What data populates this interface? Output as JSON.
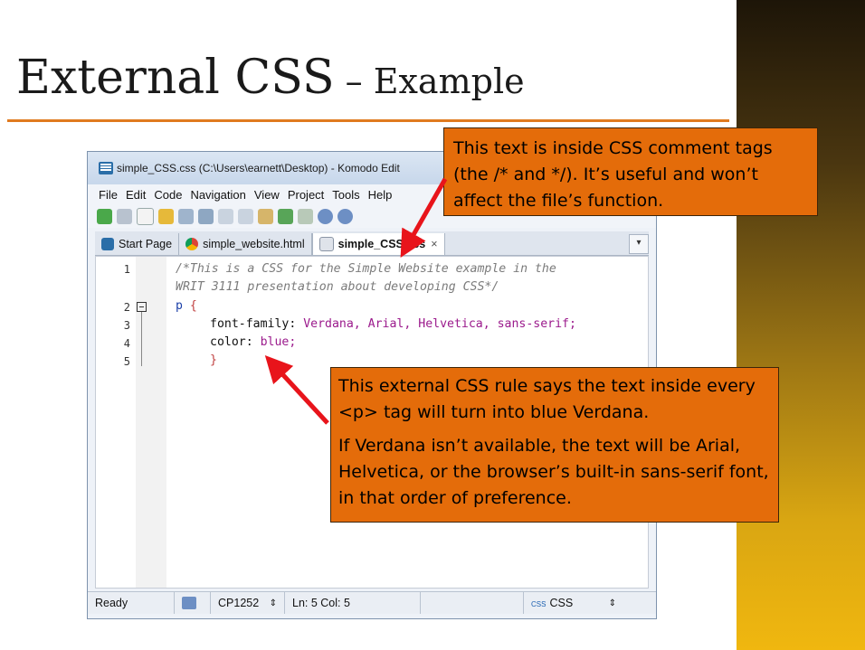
{
  "slide": {
    "title_main": "External CSS",
    "title_dash": " – ",
    "title_sub": "Example"
  },
  "window": {
    "title": "simple_CSS.css (C:\\Users\\earnett\\Desktop) - Komodo Edit",
    "menu": [
      "File",
      "Edit",
      "Code",
      "Navigation",
      "View",
      "Project",
      "Tools",
      "Help"
    ],
    "tabs": [
      {
        "label": "Start Page",
        "icon": "komodo-icon"
      },
      {
        "label": "simple_website.html",
        "icon": "chrome-icon"
      },
      {
        "label": "simple_CSS.css",
        "icon": "css-file-icon",
        "close": "×"
      }
    ],
    "tab_menu_glyph": "▾"
  },
  "editor": {
    "line_numbers": [
      "1",
      "2",
      "3",
      "4",
      "5"
    ],
    "comment_line1": "/*This is a CSS for the Simple Website example in the",
    "comment_line2": "WRIT 3111 presentation about developing CSS*/",
    "selector": "p",
    "open_brace": " {",
    "prop1": "font-family:",
    "val1": " Verdana, Arial, Helvetica, sans-serif;",
    "prop2": "color:",
    "val2": " blue;",
    "close_brace": "}"
  },
  "statusbar": {
    "ready": "Ready",
    "encoding": "CP1252",
    "position": "Ln: 5 Col: 5",
    "language_prefix": "CSS",
    "language": "CSS",
    "spinner": "⇕"
  },
  "callouts": {
    "top": "This text is inside CSS comment tags (the /* and */). It’s useful and won’t affect the file’s function.",
    "bottom_p1": "This external CSS rule says the text inside every <p> tag will turn into blue Verdana.",
    "bottom_p2": "If Verdana isn’t available, the text will be Arial, Helvetica, or the browser’s built-in sans-serif font, in that order of preference."
  },
  "colors": {
    "accent_orange": "#e46c0a",
    "title_rule": "#e07a1f",
    "arrow_red": "#e8141b"
  }
}
